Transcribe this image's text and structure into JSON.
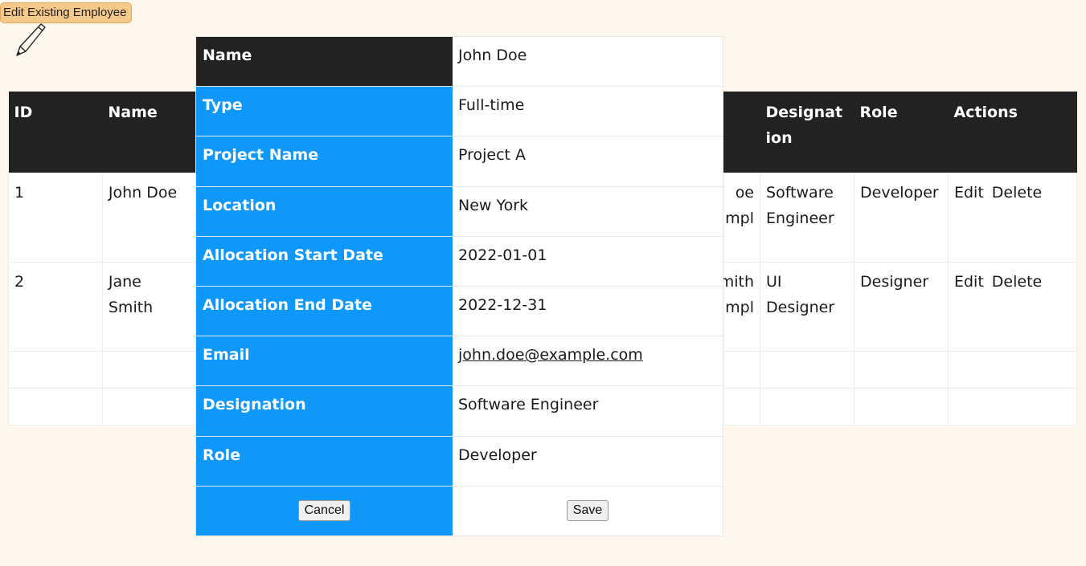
{
  "header": {
    "edit_button": "Edit Existing Employee",
    "pencil_icon": "pencil-icon"
  },
  "table": {
    "columns": [
      "ID",
      "Name",
      "",
      "",
      "",
      "",
      "",
      "",
      "Designation",
      "Role",
      "Actions"
    ],
    "rows": [
      {
        "id": "1",
        "name": "John Doe",
        "email_frag": "oe\nmpl",
        "designation": "Software Engineer",
        "role": "Developer"
      },
      {
        "id": "2",
        "name": "Jane Smith",
        "email_frag": "mith\nmpl",
        "designation": "UI Designer",
        "role": "Designer"
      }
    ],
    "edit_label": "Edit",
    "delete_label": "Delete"
  },
  "modal": {
    "fields": [
      {
        "label": "Name",
        "value": "John Doe"
      },
      {
        "label": "Type",
        "value": "Full-time"
      },
      {
        "label": "Project Name",
        "value": "Project A"
      },
      {
        "label": "Location",
        "value": "New York"
      },
      {
        "label": "Allocation Start Date",
        "value": "2022-01-01"
      },
      {
        "label": "Allocation End Date",
        "value": "2022-12-31"
      },
      {
        "label": "Email",
        "value": "john.doe@example.com"
      },
      {
        "label": "Designation",
        "value": "Software Engineer"
      },
      {
        "label": "Role",
        "value": "Developer"
      }
    ],
    "cancel_label": "Cancel",
    "save_label": "Save"
  },
  "colors": {
    "background": "#fff6ee",
    "header": "#222222",
    "accent": "#0f98fb",
    "button": "#f6c98b"
  }
}
